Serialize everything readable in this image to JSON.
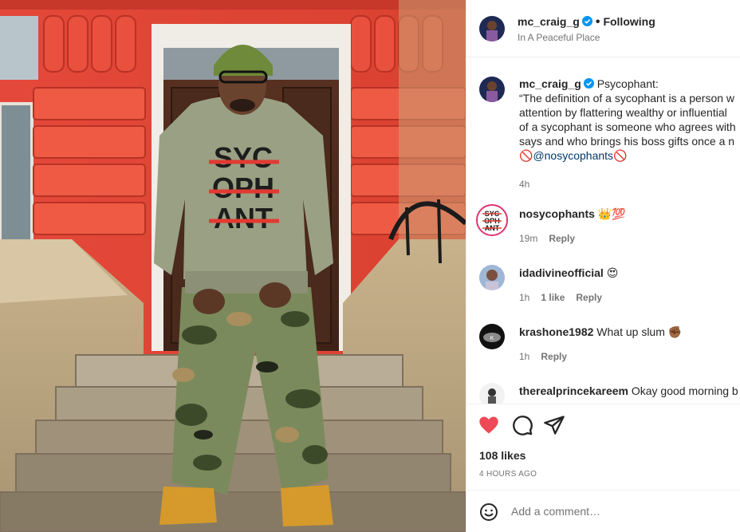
{
  "post": {
    "author": "mc_craig_g",
    "follow_label": "Following",
    "dot": "•",
    "location": "In A Peaceful Place",
    "shirt_text": [
      "SYC",
      "OPH",
      "ANT"
    ],
    "caption": {
      "author": "mc_craig_g",
      "lines": [
        "Psycophant:",
        "“The definition of a sycophant is a person w",
        "attention by flattering wealthy or influential",
        "of a sycophant is someone who agrees with",
        "says and who brings his boss gifts once a n"
      ],
      "mention_prefix": "🚫",
      "mention": "@nosycophants",
      "mention_suffix": "🚫",
      "time": "4h"
    },
    "comments": [
      {
        "user": "nosycophants",
        "text": "👑💯",
        "time": "19m",
        "likes": "",
        "reply": "Reply",
        "avatar_text": "SYC OPH ANT"
      },
      {
        "user": "idadivineofficial",
        "text": "😍",
        "time": "1h",
        "likes": "1 like",
        "reply": "Reply"
      },
      {
        "user": "krashone1982",
        "text": "What up slum ✊🏾",
        "time": "1h",
        "likes": "",
        "reply": "Reply"
      },
      {
        "user": "therealprincekareem",
        "text": "Okay good morning b",
        "time": "",
        "likes": "",
        "reply": ""
      }
    ],
    "like_count": "108 likes",
    "time_ago": "4 HOURS AGO",
    "add_comment_placeholder": "Add a comment…",
    "icons": {
      "like": "heart-filled-icon",
      "comment": "comment-bubble-icon",
      "share": "paper-plane-icon",
      "emoji": "smiley-icon",
      "verified": "verified-badge-icon"
    },
    "colors": {
      "like": "#ed4956",
      "verified": "#0095f6",
      "mention": "#00376b"
    }
  }
}
